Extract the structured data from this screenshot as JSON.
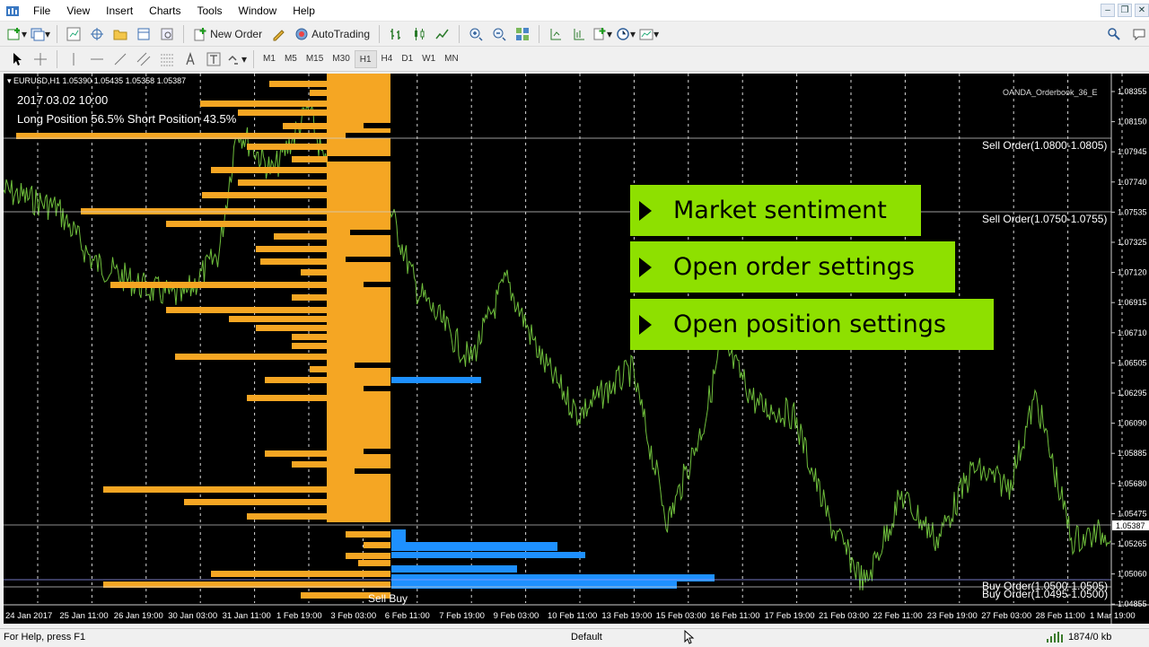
{
  "menubar": {
    "items": [
      "File",
      "View",
      "Insert",
      "Charts",
      "Tools",
      "Window",
      "Help"
    ]
  },
  "toolbar": {
    "new_order_label": "New Order",
    "autotrading_label": "AutoTrading",
    "timeframes": [
      "M1",
      "M5",
      "M15",
      "M30",
      "H1",
      "H4",
      "D1",
      "W1",
      "MN"
    ],
    "active_timeframe": "H1"
  },
  "chart": {
    "info_line": "EURUSD,H1  1.05390 1.05435 1.05358 1.05387",
    "date_label": "2017.03.02 10:00",
    "position_summary": "Long Position 56.5% Short Position 43.5%",
    "indicator_name": "OANDA_Orderbook_36_E",
    "sell_order_1": "Sell Order(1.0800-1.0805)",
    "sell_order_2": "Sell Order(1.0750-1.0755)",
    "buy_order_1": "Buy Order(1.0500-1.0505)",
    "buy_order_2": "Buy Order(1.0495-1.0500)",
    "sell_buy_label": "Sell Buy",
    "current_price": "1.05387",
    "price_labels": [
      "1.08355",
      "1.08150",
      "1.07945",
      "1.07740",
      "1.07535",
      "1.07325",
      "1.07120",
      "1.06915",
      "1.06710",
      "1.06505",
      "1.06295",
      "1.06090",
      "1.05885",
      "1.05680",
      "1.05475",
      "1.05265",
      "1.05060",
      "1.04855"
    ],
    "date_labels": [
      "24 Jan 2017",
      "25 Jan 11:00",
      "26 Jan 19:00",
      "30 Jan 03:00",
      "31 Jan 11:00",
      "1 Feb 19:00",
      "3 Feb 03:00",
      "6 Feb 11:00",
      "7 Feb 19:00",
      "9 Feb 03:00",
      "10 Feb 11:00",
      "13 Feb 19:00",
      "15 Feb 03:00",
      "16 Feb 11:00",
      "17 Feb 19:00",
      "21 Feb 03:00",
      "22 Feb 11:00",
      "23 Feb 19:00",
      "27 Feb 03:00",
      "28 Feb 11:00",
      "1 Mar 19:00"
    ],
    "colors": {
      "orange": "#f5a623",
      "blue": "#1e90ff",
      "green": "#7ec850",
      "callout": "#8ee000"
    }
  },
  "callouts": [
    "Market sentiment",
    "Open order settings",
    "Open position settings"
  ],
  "status": {
    "help": "For Help, press F1",
    "profile": "Default",
    "traffic": "1874/0 kb"
  }
}
